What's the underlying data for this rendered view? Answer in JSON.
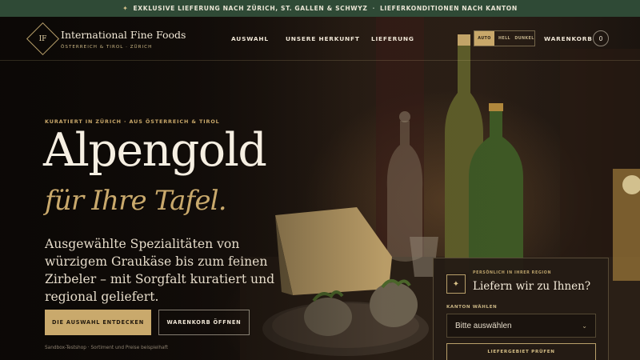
{
  "announcement": {
    "icon": "sparkle-icon",
    "part1": "EXKLUSIVE LIEFERUNG NACH ZÜRICH, ST. GALLEN & SCHWYZ",
    "separator": "·",
    "part2": "LIEFERKONDITIONEN NACH KANTON"
  },
  "brand": {
    "monogram": "IF",
    "name": "International Fine Foods",
    "tagline": "ÖSTERREICH & TIROL · ZÜRICH"
  },
  "nav": {
    "items": [
      "AUSWAHL",
      "UNSERE HERKUNFT",
      "LIEFERUNG"
    ]
  },
  "theme": {
    "options": [
      "AUTO",
      "HELL",
      "DUNKEL"
    ],
    "selected": "AUTO"
  },
  "cart": {
    "label": "WARENKORB",
    "count": "0"
  },
  "hero": {
    "eyebrow": "KURATIERT IN ZÜRICH · AUS ÖSTERREICH & TIROL",
    "headline": "Alpengold",
    "subheadline": "für Ihre Tafel.",
    "lead": "Ausgewählte Spezialitäten von würzigem Graukäse bis zum feinen Zirbeler – mit Sorgfalt kuratiert und regional geliefert.",
    "primary_cta": "DIE AUSWAHL ENTDECKEN",
    "secondary_cta": "WARENKORB ÖFFNEN",
    "disclaimer": "Sandbox-Testshop · Sortiment und Preise beispielhaft"
  },
  "delivery_card": {
    "icon": "sparkle-icon",
    "kicker": "PERSÖNLICH IN IHRER REGION",
    "title": "Liefern wir zu Ihnen?",
    "field_label": "KANTON WÄHLEN",
    "select_value": "Bitte auswählen",
    "button": "LIEFERGEBIET PRÜFEN"
  },
  "colors": {
    "accent_gold": "#c9a96c",
    "announcement_bg": "#2f4a36",
    "background_dark": "#1c150f",
    "text_light": "#f6efe2"
  }
}
